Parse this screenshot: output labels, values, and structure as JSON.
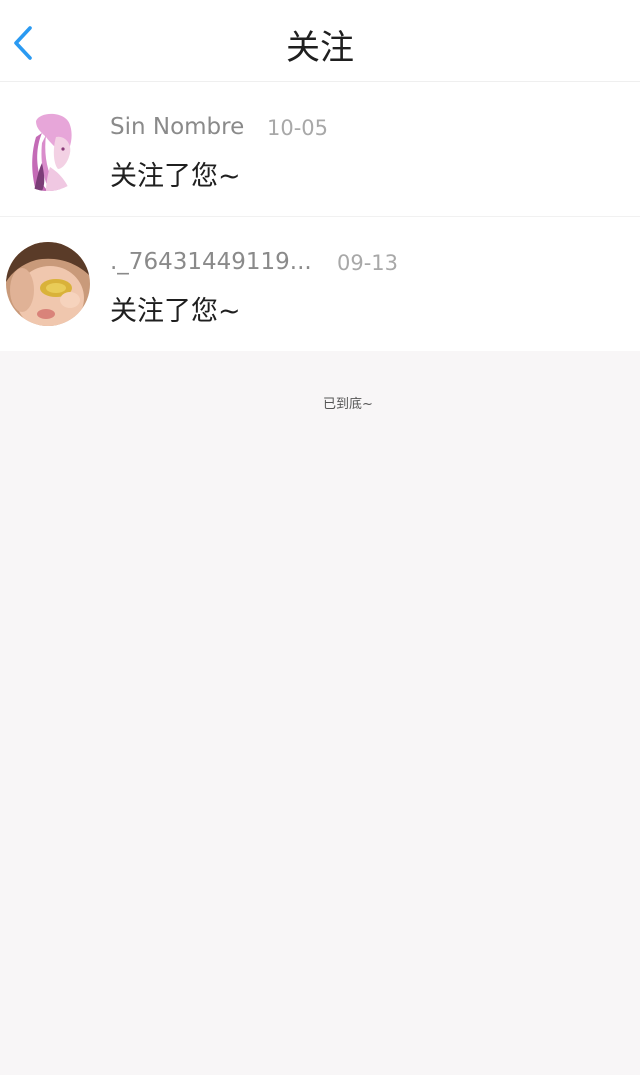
{
  "header": {
    "title": "关注",
    "back_icon": "chevron-left-icon",
    "accent_color": "#2a9af2"
  },
  "notifications": [
    {
      "name": "Sin Nombre",
      "time": "10-05",
      "message": "关注了您~",
      "avatar": "avatar-girl-pink-illustration"
    },
    {
      "name": "._76431449119...",
      "time": "09-13",
      "message": "关注了您~",
      "avatar": "avatar-child-photo"
    }
  ],
  "footer": {
    "end_text": "已到底~"
  }
}
